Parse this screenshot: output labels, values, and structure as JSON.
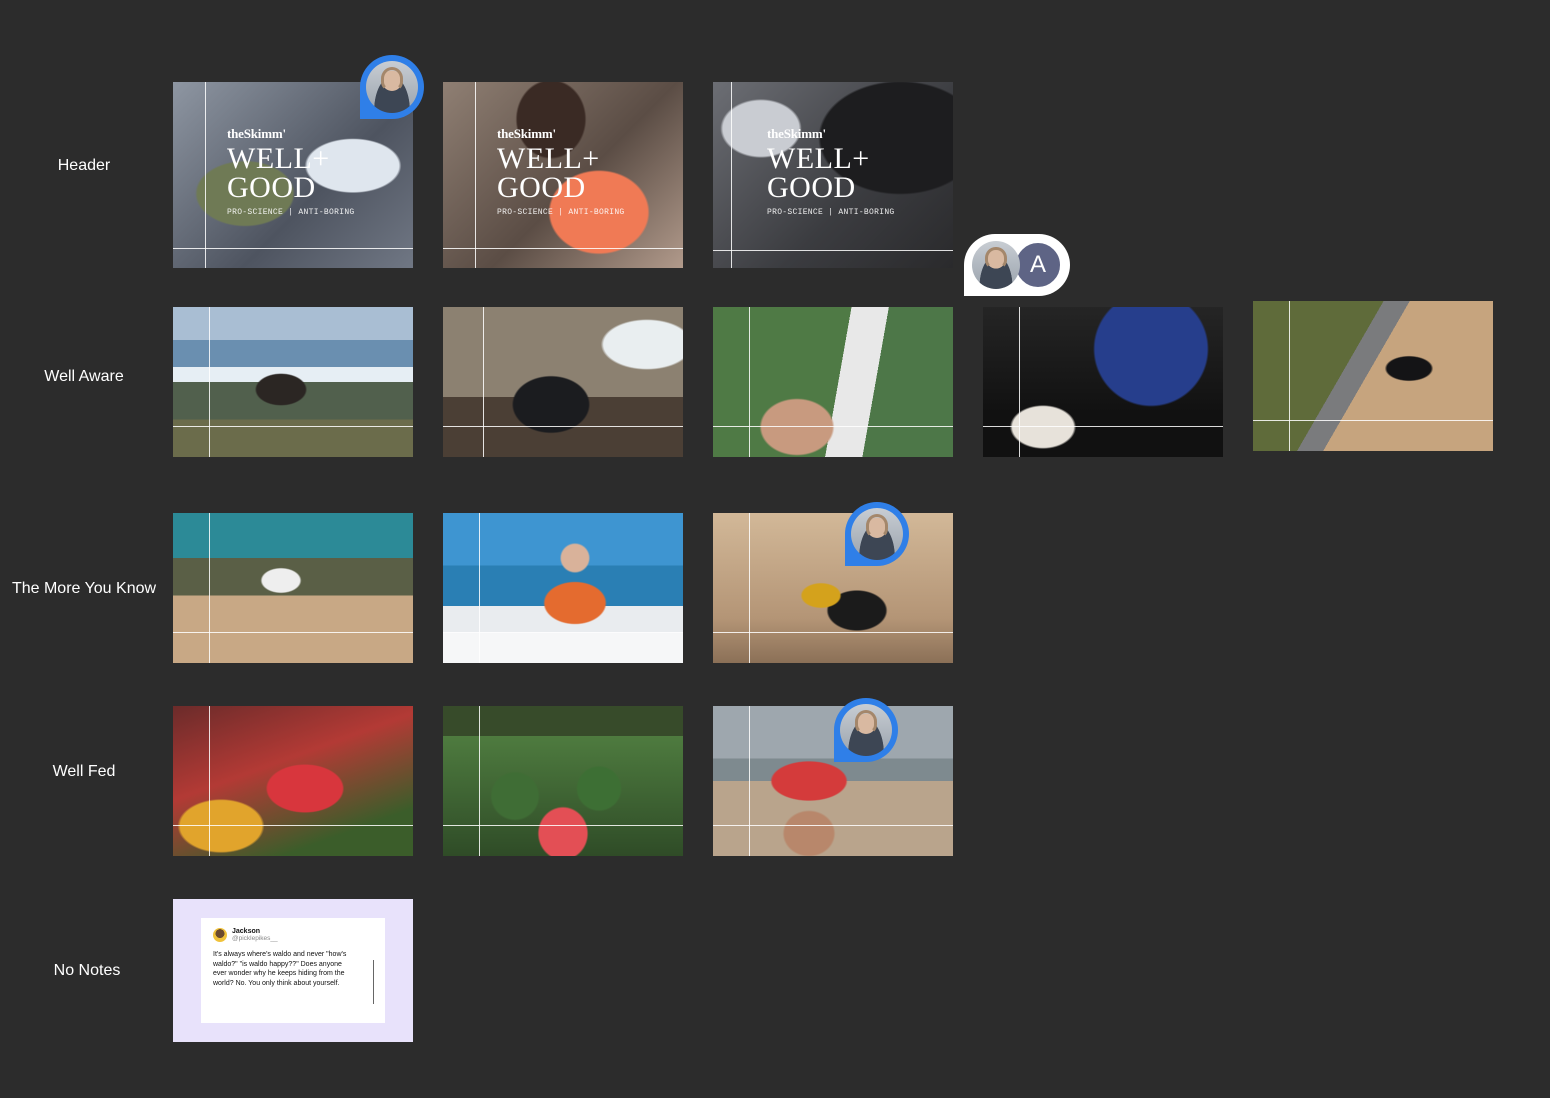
{
  "rows": [
    {
      "label": "Header"
    },
    {
      "label": "Well Aware"
    },
    {
      "label": "The More You Know"
    },
    {
      "label": "Well Fed"
    },
    {
      "label": "No Notes"
    }
  ],
  "header_brand": {
    "logo": "theSkimm'",
    "title_line1": "WELL+",
    "title_line2": "GOOD",
    "tagline": "PRO-SCIENCE | ANTI-BORING"
  },
  "comment_group": {
    "letter": "A"
  },
  "tweet": {
    "name": "Jackson",
    "handle": "@picklepikes__",
    "text": "It's always where's waldo and never \"how's waldo?\" \"is waldo happy??\" Does anyone ever wonder why he keeps hiding from the world? No. You only think about yourself."
  },
  "colors": {
    "background": "#2c2c2c",
    "pin_blue": "#2f7fe8",
    "letter_avatar": "#5e6485",
    "tweet_bg": "#e8e2fb"
  }
}
